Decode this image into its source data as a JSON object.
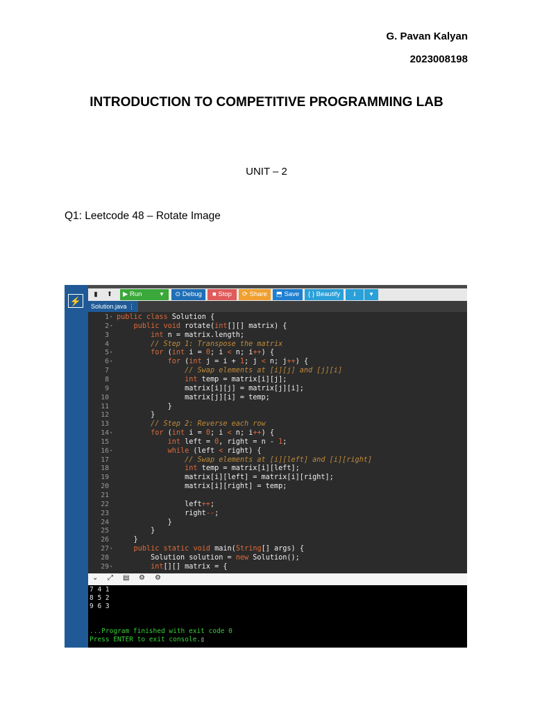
{
  "header": {
    "author_name": "G. Pavan Kalyan",
    "roll_number": "2023008198",
    "title": "INTRODUCTION TO COMPETITIVE PROGRAMMING LAB",
    "unit": "UNIT – 2",
    "question": "Q1: Leetcode 48 – Rotate Image"
  },
  "ide": {
    "toolbar": {
      "run": "▶ Run",
      "run_menu": "▾",
      "debug": "⊙ Debug",
      "stop": "■ Stop",
      "share": "⟳ Share",
      "save": "⬒ Save",
      "beautify": "{ } Beautify",
      "download": "⭳",
      "download_menu": "▾",
      "new_file": "▮",
      "upload": "⬆"
    },
    "tab": "Solution.java ⋮",
    "code_lines": [
      {
        "n": "1",
        "t": "public class Solution {"
      },
      {
        "n": "2",
        "t": "    public void rotate(int[][] matrix) {"
      },
      {
        "n": "3",
        "t": "        int n = matrix.length;"
      },
      {
        "n": "4",
        "t": "        // Step 1: Transpose the matrix"
      },
      {
        "n": "5",
        "t": "        for (int i = 0; i < n; i++) {"
      },
      {
        "n": "6",
        "t": "            for (int j = i + 1; j < n; j++) {"
      },
      {
        "n": "7",
        "t": "                // Swap elements at [i][j] and [j][i]"
      },
      {
        "n": "8",
        "t": "                int temp = matrix[i][j];"
      },
      {
        "n": "9",
        "t": "                matrix[i][j] = matrix[j][i];"
      },
      {
        "n": "10",
        "t": "                matrix[j][i] = temp;"
      },
      {
        "n": "11",
        "t": "            }"
      },
      {
        "n": "12",
        "t": "        }"
      },
      {
        "n": "13",
        "t": "        // Step 2: Reverse each row"
      },
      {
        "n": "14",
        "t": "        for (int i = 0; i < n; i++) {"
      },
      {
        "n": "15",
        "t": "            int left = 0, right = n - 1;"
      },
      {
        "n": "16",
        "t": "            while (left < right) {"
      },
      {
        "n": "17",
        "t": "                // Swap elements at [i][left] and [i][right]"
      },
      {
        "n": "18",
        "t": "                int temp = matrix[i][left];"
      },
      {
        "n": "19",
        "t": "                matrix[i][left] = matrix[i][right];"
      },
      {
        "n": "20",
        "t": "                matrix[i][right] = temp;"
      },
      {
        "n": "21",
        "t": ""
      },
      {
        "n": "22",
        "t": "                left++;"
      },
      {
        "n": "23",
        "t": "                right--;"
      },
      {
        "n": "24",
        "t": "            }"
      },
      {
        "n": "25",
        "t": "        }"
      },
      {
        "n": "26",
        "t": "    }"
      },
      {
        "n": "27",
        "t": "    public static void main(String[] args) {"
      },
      {
        "n": "28",
        "t": "        Solution solution = new Solution();"
      },
      {
        "n": "29",
        "t": "        int[][] matrix = {"
      }
    ],
    "console_output": [
      "7 4 1",
      "8 5 2",
      "9 6 3",
      "",
      "",
      "...Program finished with exit code 0",
      "Press ENTER to exit console."
    ],
    "colors": {
      "run": "#3aa83a",
      "debug": "#1f6fb5",
      "stop": "#e05a5a",
      "share": "#f0a030",
      "save": "#1f7fd0",
      "beautify": "#2aa0d8",
      "download": "#2aa0d8",
      "sidebar": "#1f5a96"
    }
  }
}
